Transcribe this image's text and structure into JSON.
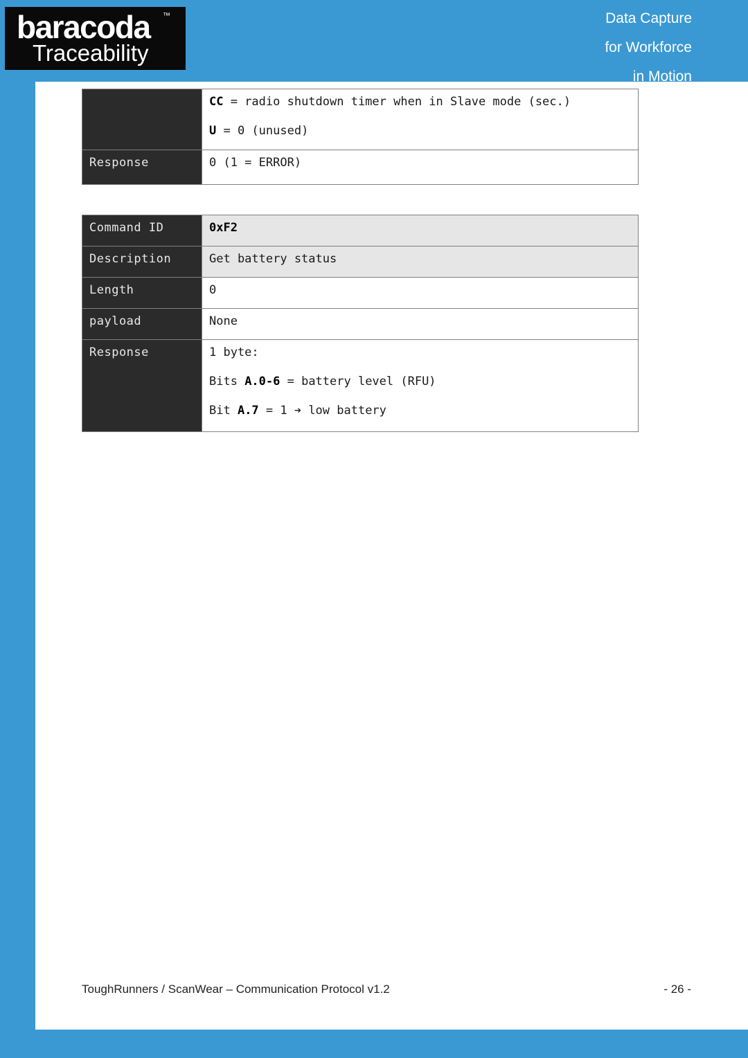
{
  "header": {
    "logo": {
      "brand": "baracoda",
      "trademark": "™",
      "sub": "Traceability"
    },
    "tagline": {
      "line1": "Data Capture",
      "line2": "for Workforce",
      "line3": "in Motion"
    },
    "band_color": "#3a99d3"
  },
  "tables": [
    {
      "id": "table-1",
      "rows": [
        {
          "label": "",
          "label_blank": true,
          "shaded": false,
          "lines": [
            {
              "bold": "CC",
              "rest": " = radio shutdown timer when in Slave mode (sec.)"
            },
            {
              "bold": "U",
              "rest": " = 0 (unused)"
            }
          ]
        },
        {
          "label": "Response",
          "label_blank": false,
          "shaded": false,
          "lines": [
            {
              "bold": "",
              "rest": "0 (1 = ERROR)"
            }
          ]
        }
      ]
    },
    {
      "id": "table-2",
      "rows": [
        {
          "label": "Command ID",
          "label_blank": false,
          "shaded": true,
          "lines": [
            {
              "bold": "0xF2",
              "rest": ""
            }
          ]
        },
        {
          "label": "Description",
          "label_blank": false,
          "shaded": true,
          "lines": [
            {
              "bold": "",
              "rest": "Get battery status"
            }
          ]
        },
        {
          "label": "Length",
          "label_blank": false,
          "shaded": false,
          "lines": [
            {
              "bold": "",
              "rest": "0"
            }
          ]
        },
        {
          "label": "payload",
          "label_blank": false,
          "shaded": false,
          "lines": [
            {
              "bold": "",
              "rest": "None"
            }
          ]
        },
        {
          "label": "Response",
          "label_blank": false,
          "shaded": false,
          "lines": [
            {
              "bold": "",
              "rest": "1 byte:"
            },
            {
              "pre": "Bits ",
              "bold": "A.0-6",
              "rest": " = battery level (RFU)"
            },
            {
              "pre": "Bit ",
              "bold": "A.7",
              "rest": " = 1 ➔ low battery"
            }
          ]
        }
      ]
    }
  ],
  "footer": {
    "text": "ToughRunners / ScanWear – Communication Protocol v1.2",
    "page": "- 26 -"
  }
}
